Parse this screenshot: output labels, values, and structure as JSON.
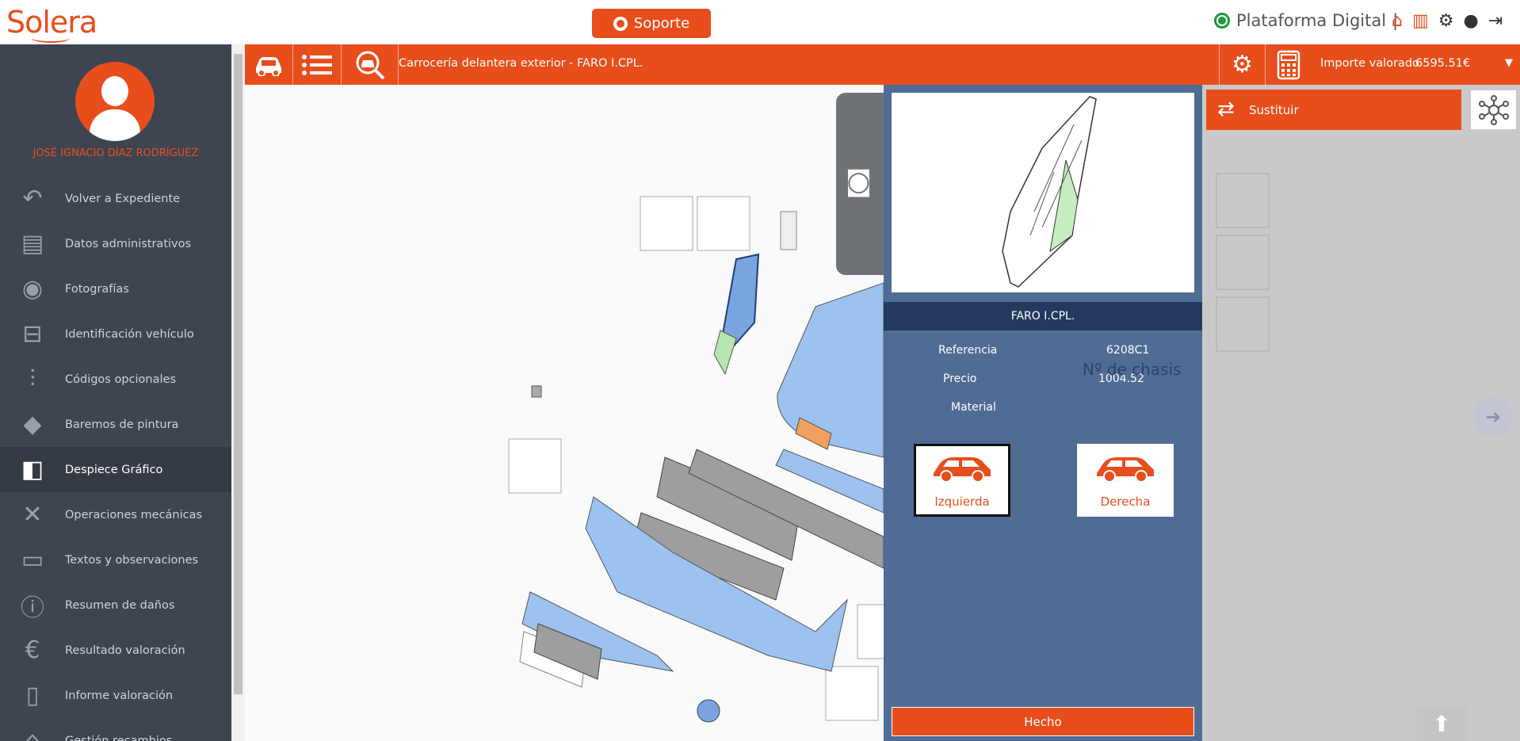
{
  "header": {
    "logo_text": "Solera",
    "support_label": "Soporte",
    "platform_label": "Plataforma Digital",
    "separator": "|"
  },
  "user": {
    "name": "JOSÉ IGNACIO DÍAZ RODRÍGUEZ"
  },
  "sidebar": {
    "items": [
      {
        "label": "Volver a Expediente",
        "icon": "back-arrow-icon",
        "glyph": "↶"
      },
      {
        "label": "Datos administrativos",
        "icon": "admin-data-icon",
        "glyph": "▤"
      },
      {
        "label": "Fotografías",
        "icon": "camera-icon",
        "glyph": "◉"
      },
      {
        "label": "Identificación vehículo",
        "icon": "car-icon",
        "glyph": "⊟"
      },
      {
        "label": "Códigos opcionales",
        "icon": "sliders-icon",
        "glyph": "⫶"
      },
      {
        "label": "Baremos de pintura",
        "icon": "paint-bucket-icon",
        "glyph": "◆"
      },
      {
        "label": "Despiece Gráfico",
        "icon": "headlight-icon",
        "glyph": "◧"
      },
      {
        "label": "Operaciones mecánicas",
        "icon": "tools-icon",
        "glyph": "✕"
      },
      {
        "label": "Textos y observaciones",
        "icon": "document-icon",
        "glyph": "▭"
      },
      {
        "label": "Resumen de daños",
        "icon": "info-icon",
        "glyph": "ⓘ"
      },
      {
        "label": "Resultado valoración",
        "icon": "euro-icon",
        "glyph": "€"
      },
      {
        "label": "Informe valoración",
        "icon": "pdf-icon",
        "glyph": "▯"
      },
      {
        "label": "Gestión recambios",
        "icon": "car-parts-icon",
        "glyph": "⌂"
      }
    ],
    "active_index": 6
  },
  "toolbar": {
    "breadcrumb": "Carrocería delantera exterior - FARO I.CPL.",
    "importe_label": "Importe valorado",
    "importe_value": "6595.51€",
    "caret": "▼"
  },
  "part_detail": {
    "name": "FARO I.CPL.",
    "reference_label": "Referencia",
    "reference_value": "6208C1",
    "price_label": "Precio",
    "price_value": "1004.52",
    "material_label": "Material",
    "ghost_label": "Nº de chasis",
    "left_label": "Izquierda",
    "right_label": "Derecha",
    "selected_side": "left",
    "done_label": "Hecho"
  },
  "actions": {
    "replace_label": "Sustituir"
  },
  "colors": {
    "accent": "#e84e1b",
    "sidebar_bg": "#3e4551",
    "panel_bg": "#4f6c94",
    "panel_header": "#233a5e",
    "part_blue": "#9cc2ef",
    "part_grey": "#9e9e9e",
    "part_green": "#b6e6b0"
  }
}
